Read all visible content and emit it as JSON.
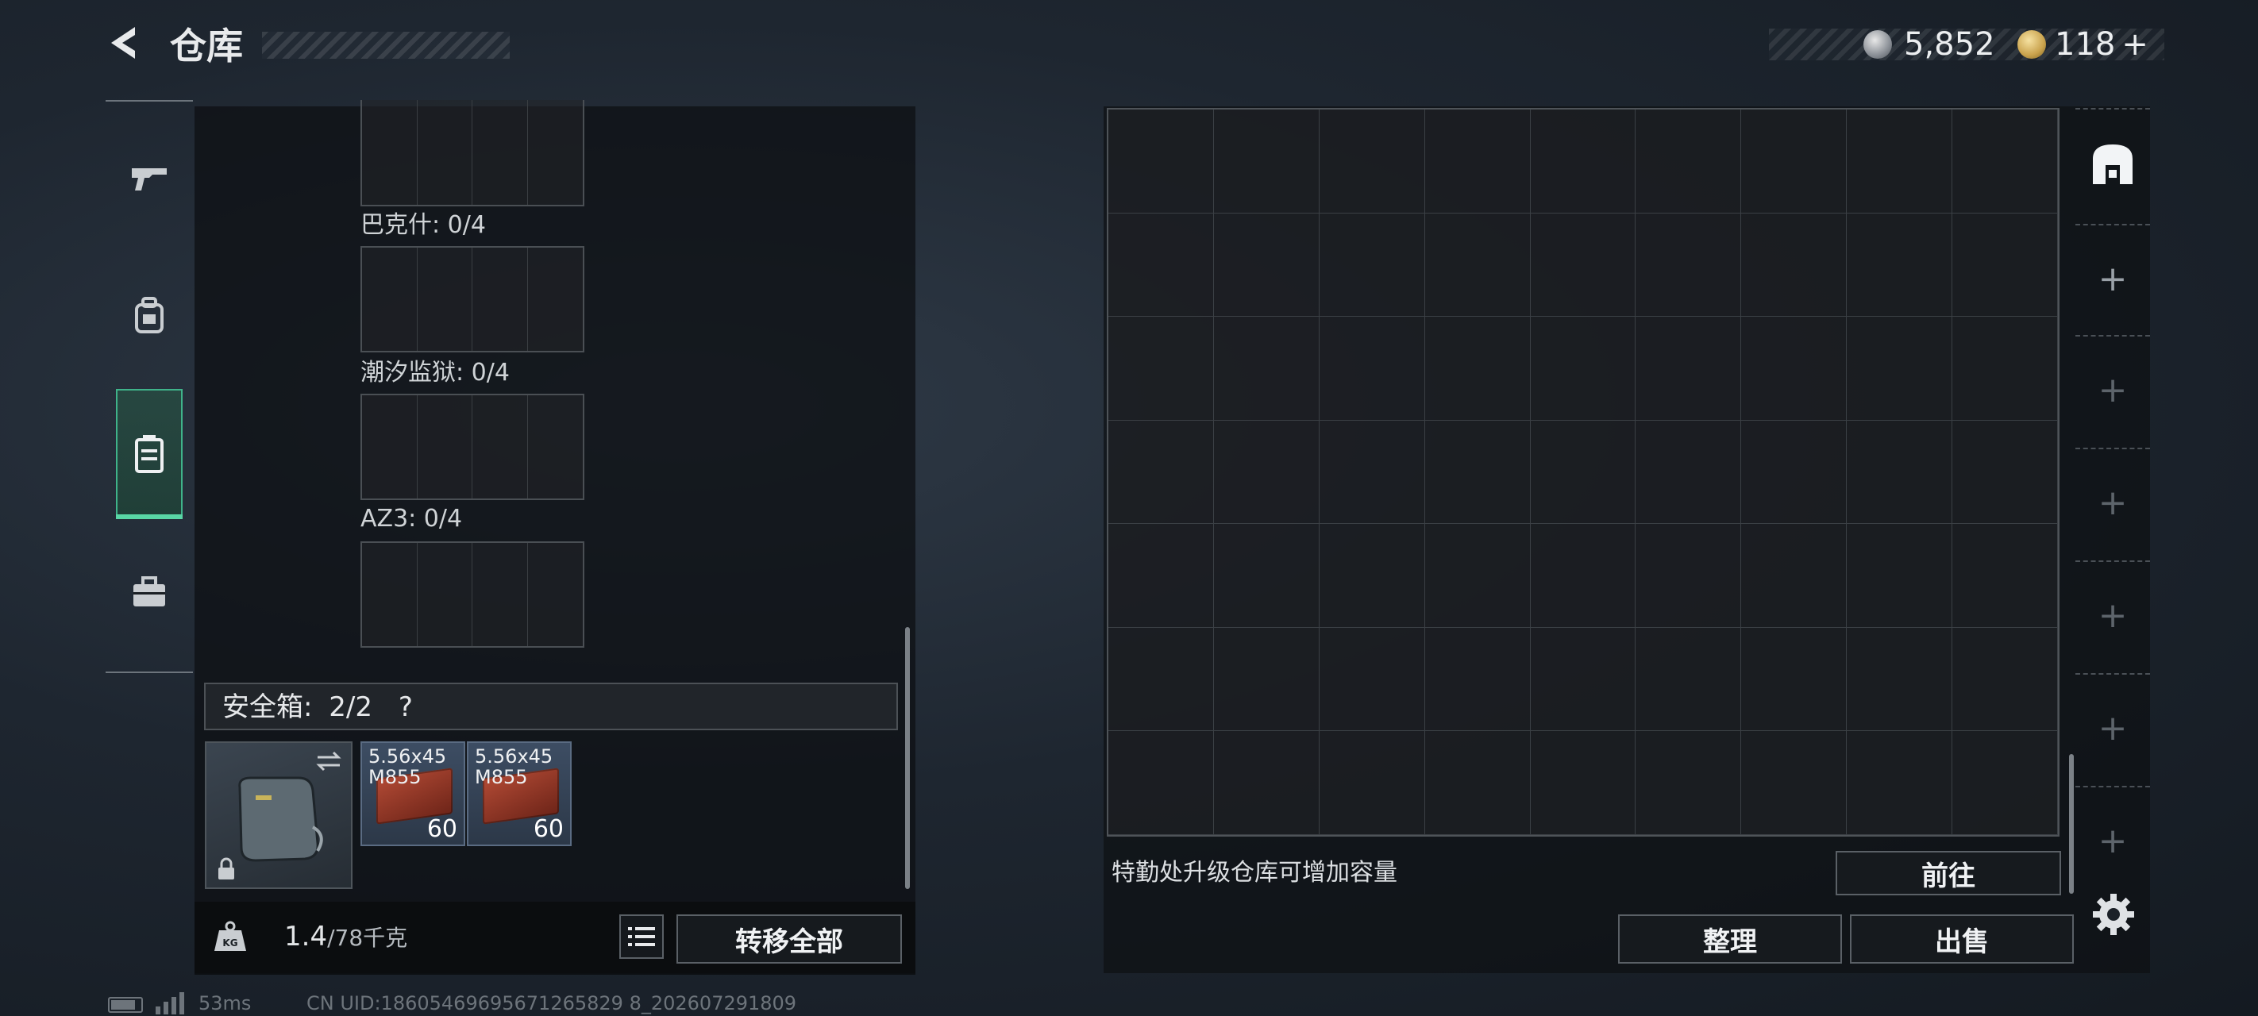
{
  "header": {
    "title": "仓库",
    "currency_silver": "5,852",
    "currency_gold": "118",
    "currency_gold_add": "+"
  },
  "left_nav": {
    "items": [
      "gun-icon",
      "backpack-icon",
      "storage-case-icon",
      "toolbox-icon"
    ],
    "active_index": 2
  },
  "slots": [
    {
      "label": "巴克什: 0/4"
    },
    {
      "label": "潮汐监狱: 0/4"
    },
    {
      "label": "AZ3: 0/4"
    }
  ],
  "safe_box": {
    "label": "安全箱:",
    "count": "2/2",
    "help": "?",
    "items": [
      {
        "name": "5.56x45 M855",
        "count": "60"
      },
      {
        "name": "5.56x45 M855",
        "count": "60"
      }
    ]
  },
  "weight": {
    "current": "1.4",
    "max": "/78千克"
  },
  "buttons": {
    "transfer_all": "转移全部",
    "goto": "前往",
    "sort": "整理",
    "sell": "出售"
  },
  "storage": {
    "upgrade_hint": "特勤处升级仓库可增加容量"
  },
  "footer": {
    "ping": "53ms",
    "uid": "CN UID:18605469695671265829 8_202607291809"
  }
}
